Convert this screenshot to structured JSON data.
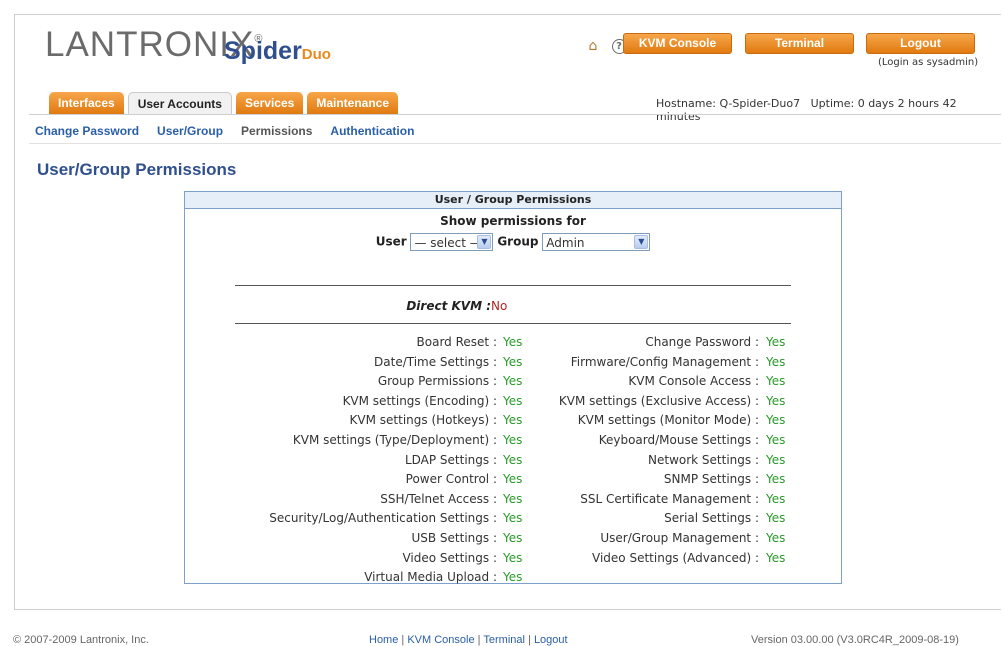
{
  "brand": {
    "lantronix_a": "LANTRONIX",
    "reg": "®",
    "spider": "Spider",
    "duo": "Duo"
  },
  "header": {
    "kvm_console": "KVM Console",
    "terminal": "Terminal",
    "logout": "Logout",
    "login_as": "(Login as sysadmin)",
    "hostname": "Hostname: Q-Spider-Duo7",
    "uptime": "Uptime: 0 days 2 hours 42 minutes"
  },
  "tabs": [
    "Interfaces",
    "User Accounts",
    "Services",
    "Maintenance"
  ],
  "active_tab": "User Accounts",
  "subnav": [
    "Change Password",
    "User/Group",
    "Permissions",
    "Authentication"
  ],
  "current_subnav": "Permissions",
  "page_title": "User/Group Permissions",
  "panel": {
    "title": "User / Group Permissions",
    "show_for": "Show permissions for",
    "user_label": "User",
    "user_value": "— select —",
    "group_label": "Group",
    "group_value": "Admin",
    "direct_kvm_label": "Direct KVM :",
    "direct_kvm_value": "No"
  },
  "permissions": [
    [
      "Board Reset :",
      "Yes",
      "Change Password :",
      "Yes"
    ],
    [
      "Date/Time Settings :",
      "Yes",
      "Firmware/Config Management :",
      "Yes"
    ],
    [
      "Group Permissions :",
      "Yes",
      "KVM Console Access :",
      "Yes"
    ],
    [
      "KVM settings (Encoding) :",
      "Yes",
      "KVM settings (Exclusive Access) :",
      "Yes"
    ],
    [
      "KVM settings (Hotkeys) :",
      "Yes",
      "KVM settings (Monitor Mode) :",
      "Yes"
    ],
    [
      "KVM settings (Type/Deployment) :",
      "Yes",
      "Keyboard/Mouse Settings :",
      "Yes"
    ],
    [
      "LDAP Settings :",
      "Yes",
      "Network Settings :",
      "Yes"
    ],
    [
      "Power Control :",
      "Yes",
      "SNMP Settings :",
      "Yes"
    ],
    [
      "SSH/Telnet Access :",
      "Yes",
      "SSL Certificate Management :",
      "Yes"
    ],
    [
      "Security/Log/Authentication Settings :",
      "Yes",
      "Serial Settings :",
      "Yes"
    ],
    [
      "USB Settings :",
      "Yes",
      "User/Group Management :",
      "Yes"
    ],
    [
      "Video Settings :",
      "Yes",
      "Video Settings (Advanced) :",
      "Yes"
    ],
    [
      "Virtual Media Upload :",
      "Yes",
      "",
      ""
    ]
  ],
  "footer": {
    "copyright": "© 2007-2009 Lantronix, Inc.",
    "links": [
      "Home",
      "KVM Console",
      "Terminal",
      "Logout"
    ],
    "separator": "|",
    "version": "Version 03.00.00 (V3.0RC4R_2009-08-19)"
  }
}
